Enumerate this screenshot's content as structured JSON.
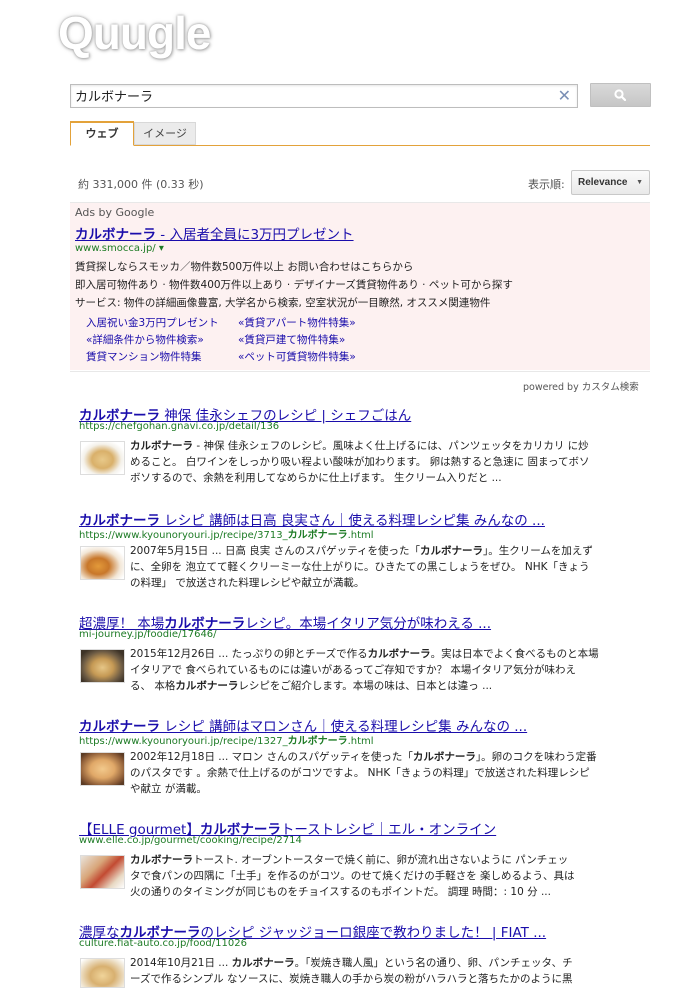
{
  "logo": "Quugle",
  "search": {
    "query": "カルボナーラ"
  },
  "tabs": {
    "web": "ウェブ",
    "image": "イメージ"
  },
  "stats": {
    "count": "約 331,000 件 (0.33 秒)",
    "sort_label": "表示順:",
    "sort_value": "Relevance"
  },
  "ads": {
    "label": "Ads by Google",
    "title_bold": "カルボナーラ",
    "title_rest": " - 入居者全員に3万円プレゼント",
    "url": "www.smocca.jp/ ▾",
    "desc1": "賃貸探しならスモッカ／物件数500万件以上 お問い合わせはこちらから",
    "desc2": "即入居可物件あり · 物件数400万件以上あり · デザイナーズ賃貸物件あり · ペット可から探す",
    "desc3": "サービス: 物件の詳細画像豊富, 大学名から検索, 空室状況が一目瞭然, オススメ関連物件",
    "links": [
      "入居祝い金3万円プレゼント",
      "«賃貸アパート物件特集»",
      "«詳細条件から物件検索»",
      "«賃貸戸建て物件特集»",
      "賃貸マンション物件特集",
      "«ペット可賃貸物件特集»"
    ]
  },
  "powered_by": "powered by カスタム検索",
  "results": [
    {
      "title_bold": "カルボナーラ",
      "title_rest": " 神保 佳永シェフのレシピ | シェフごはん",
      "url": "https://chefgohan.gnavi.co.jp/detail/136",
      "line1_bold": "カルボナーラ",
      "line1": " - 神保 佳永シェフのレシピ。風味よく仕上げるには、パンツェッタをカリカリ に炒",
      "line2": "めること。 白ワインをしっかり吸い程よい酸味が加わります。 卵は熱すると急速に 固まってボソ",
      "line3": "ボソするので、余熱を利用してなめらかに仕上げます。 生クリーム入りだと ..."
    },
    {
      "title_bold": "カルボナーラ",
      "title_rest": " レシピ 講師は日高 良実さん｜使える料理レシピ集 みんなの ...",
      "url_pre": "https://www.kyounoryouri.jp/recipe/3713_",
      "url_bold": "カルボナーラ",
      "url_post": ".html",
      "line1_pre": "2007年5月15日 ... 日高 良実 さんのスパゲッティを使った「",
      "line1_bold": "カルボナーラ",
      "line1_post": "」。生クリームを加えず",
      "line2": "に、全卵を 泡立てて軽くクリーミーな仕上がりに。ひきたての黒こしょうをぜひ。 NHK「きょう",
      "line3": "の料理」 で放送された料理レシピや献立が満載。"
    },
    {
      "title_pre": "超濃厚！ 本場",
      "title_bold": "カルボナーラ",
      "title_rest": "レシピ。本場イタリア気分が味わえる ...",
      "url": "mi-journey.jp/foodie/17646/",
      "line1": "2015年12月26日 ... たっぷりの卵とチーズで作る",
      "line1_bold": "カルボナーラ",
      "line1_post": "。実は日本でよく食べるものと本場",
      "line2": "イタリアで 食べられているものには違いがあるってご存知ですか？ 本場イタリア気分が味わえ",
      "line3_pre": "る、 本格",
      "line3_bold": "カルボナーラ",
      "line3_post": "レシピをご紹介します。本場の味は、日本とは違っ ..."
    },
    {
      "title_bold": "カルボナーラ",
      "title_rest": " レシピ 講師はマロンさん｜使える料理レシピ集 みんなの ...",
      "url_pre": "https://www.kyounoryouri.jp/recipe/1327_",
      "url_bold": "カルボナーラ",
      "url_post": ".html",
      "line1_pre": "2002年12月18日 ... マロン さんのスパゲッティを使った「",
      "line1_bold": "カルボナーラ",
      "line1_post": "」。卵のコクを味わう定番",
      "line2": "のパスタです 。余熱で仕上げるのがコツですよ。 NHK「きょうの料理」で放送された料理レシピ",
      "line3": "や献立 が満載。"
    },
    {
      "title_pre": "【ELLE gourmet】",
      "title_bold": "カルボナーラ",
      "title_rest": "トーストレシピ｜エル・オンライン",
      "url": "www.elle.co.jp/gourmet/cooking/recipe/2714",
      "line1_bold": "カルボナーラ",
      "line1": "トースト. オーブントースターで焼く前に、卵が流れ出さないように パンチェッ",
      "line2": "タで食パンの四隅に「土手」を作るのがコツ。のせて焼くだけの手軽さを 楽しめるよう、具は",
      "line3": "火の通りのタイミングが同じものをチョイスするのもポイントだ。 調理 時間：: 10 分 ..."
    },
    {
      "title_pre": "濃厚な",
      "title_bold": "カルボナーラ",
      "title_rest": "のレシピ ジャッジョーロ銀座で教わりました！ | FIAT ...",
      "url": "culture.fiat-auto.co.jp/food/11026",
      "line1_pre": "2014年10月21日 ... ",
      "line1_bold": "カルボナーラ",
      "line1_post": "。「炭焼き職人風」という名の通り、卵、パンチェッタ、チ",
      "line2": "ーズで作るシンプル なソースに、炭焼き職人の手から炭の粉がハラハラと落ちたかのように黒"
    }
  ],
  "colors": {
    "link": "#1a0dab",
    "url": "#1d7b25",
    "accent": "#e3a23a",
    "ad_bg": "#fdf1f1"
  }
}
